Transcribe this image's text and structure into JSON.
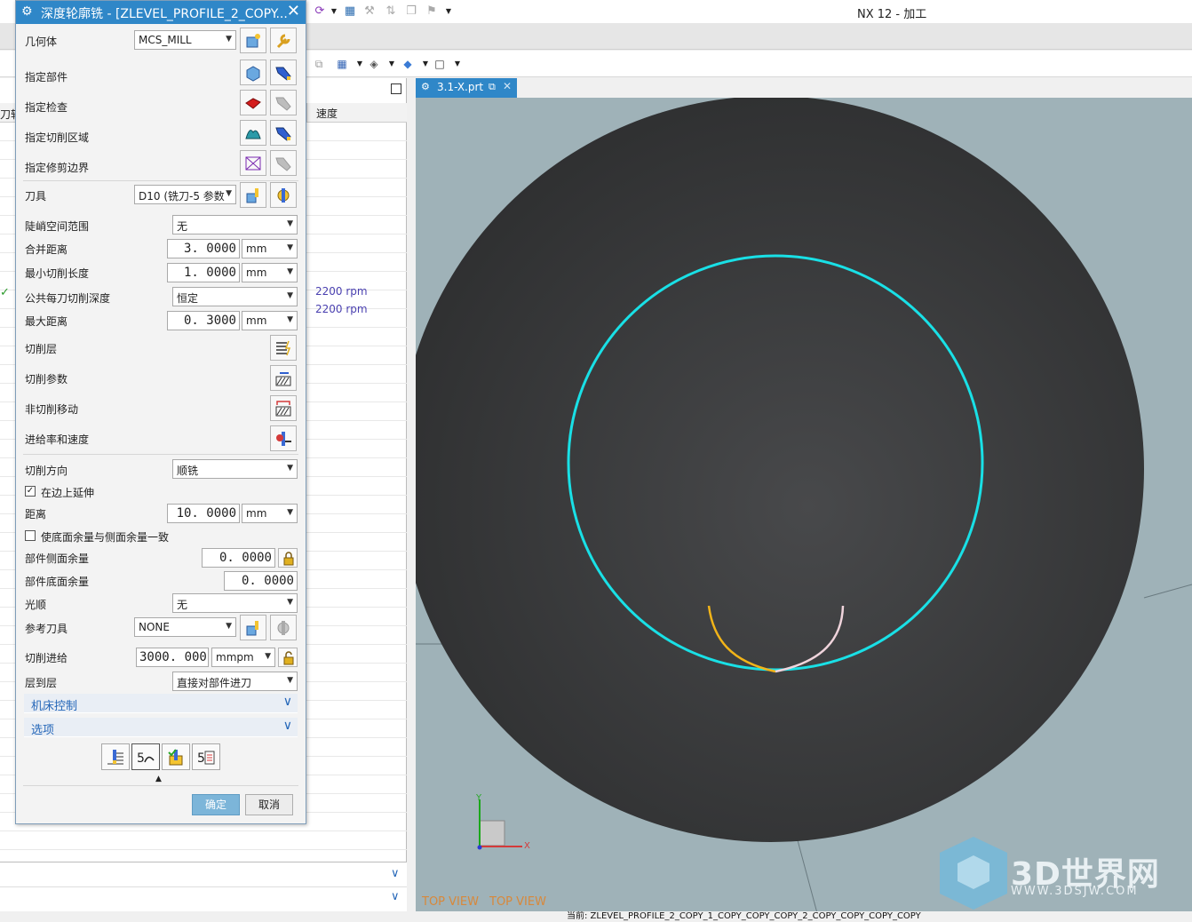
{
  "app": {
    "title": "NX 12 - 加工"
  },
  "navigator": {
    "col_partial": "刀轨",
    "col_speed": "速度",
    "rpm_values": [
      "2200 rpm",
      "2200 rpm"
    ]
  },
  "viewport": {
    "tab_label": "3.1-X.prt",
    "view_label_1": "TOP VIEW",
    "view_label_2": "TOP VIEW",
    "axis_x": "X",
    "axis_y": "Y",
    "watermark": "3D世界网",
    "watermark_url": "WWW.3DSJW.COM",
    "status": "当前: ZLEVEL_PROFILE_2_COPY_1_COPY_COPY_COPY_2_COPY_COPY_COPY_COPY",
    "colors": {
      "body": "#3a3c3e",
      "circle": "#19e0e6",
      "lead_in": "#f2b418",
      "lead_out": "#f0d4dc"
    }
  },
  "dialog": {
    "title": "深度轮廓铣 - [ZLEVEL_PROFILE_2_COPY...",
    "geometry_label": "几何体",
    "geometry_value": "MCS_MILL",
    "specify_part": "指定部件",
    "specify_check": "指定检查",
    "specify_cut_area": "指定切削区域",
    "specify_trim": "指定修剪边界",
    "tool_label": "刀具",
    "tool_value": "D10 (铣刀-5 参数",
    "steep_label": "陡峭空间范围",
    "steep_value": "无",
    "merge_label": "合并距离",
    "merge_value": "3. 0000",
    "min_cut_label": "最小切削长度",
    "min_cut_value": "1. 0000",
    "depth_label": "公共每刀切削深度",
    "depth_value": "恒定",
    "max_dist_label": "最大距离",
    "max_dist_value": "0. 3000",
    "unit_mm": "mm",
    "cut_levels": "切削层",
    "cut_params": "切削参数",
    "non_cut": "非切削移动",
    "feeds": "进给率和速度",
    "cut_dir_label": "切削方向",
    "cut_dir_value": "顺铣",
    "extend_label": "在边上延伸",
    "distance_label": "距离",
    "distance_value": "10. 0000",
    "same_stock_label": "使底面余量与侧面余量一致",
    "side_stock_label": "部件侧面余量",
    "side_stock_value": "0. 0000",
    "floor_stock_label": "部件底面余量",
    "floor_stock_value": "0. 0000",
    "smooth_label": "光顺",
    "smooth_value": "无",
    "ref_tool_label": "参考刀具",
    "ref_tool_value": "NONE",
    "feed_label": "切削进给",
    "feed_value": "3000. 000",
    "feed_unit": "mmpm",
    "level_label": "层到层",
    "level_value": "直接对部件进刀",
    "machine_control": "机床控制",
    "options": "选项",
    "ok": "确定",
    "cancel": "取消"
  }
}
